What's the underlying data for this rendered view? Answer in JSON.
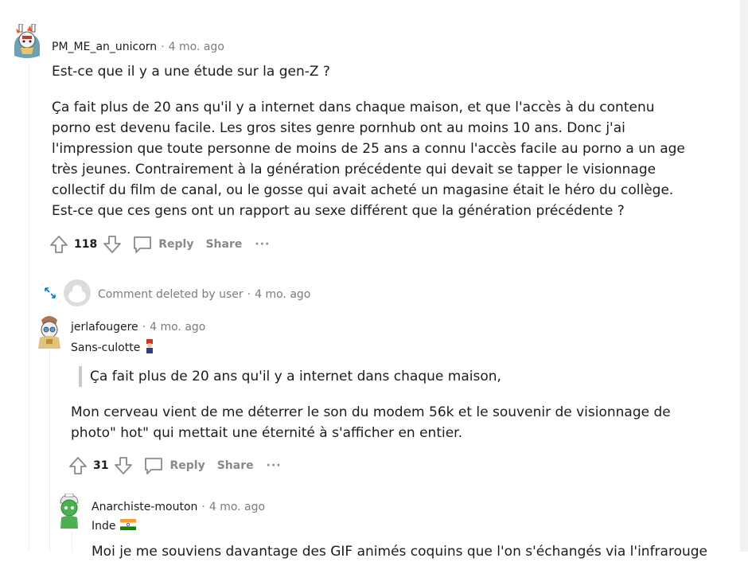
{
  "comments": [
    {
      "username": "PM_ME_an_unicorn",
      "age": "4 mo. ago",
      "paragraphs": [
        "Est-ce que il y a une étude sur la gen-Z ?",
        "Ça fait plus de 20 ans qu'il y a internet dans chaque maison, et que l'accès à du contenu porno est devenu facile. Les gros sites genre pornhub ont au moins 10 ans. Donc j'ai l'impression que toute personne de moins de 25 ans a connu l'accès facile au porno a un age très jeunes. Contrairement à la génération précédente qui devait se tapper le visionnage collectif du film de canal, ou le gosse qui avait acheté un magasine était le héro du collège. Est-ce que ces gens ont un rapport au sexe différent que la génération précédente ?"
      ],
      "votes": "118"
    },
    {
      "deleted_label": "Comment deleted by user",
      "age": "4 mo. ago"
    },
    {
      "username": "jerlafougere",
      "age": "4 mo. ago",
      "flair": "Sans-culotte",
      "quote": "Ça fait plus de 20 ans qu'il y a internet dans chaque maison,",
      "paragraph": "Mon cerveau vient de me déterrer le son du modem 56k et le souvenir de visionnage de photo\" hot\" qui mettait une éternité à s'afficher en entier.",
      "votes": "31"
    },
    {
      "username": "Anarchiste-mouton",
      "age": "4 mo. ago",
      "flair": "Inde",
      "paragraph_partial": "Moi je me souviens davantage des GIF animés coquins que l'on s'échangés via l'infrarouge"
    }
  ],
  "actions": {
    "reply": "Reply",
    "share": "Share",
    "more": "···"
  },
  "colors": {
    "meta_gray": "#7c7c7c",
    "action_gray": "#878a8c",
    "quote_bar": "#c8cbcd"
  }
}
